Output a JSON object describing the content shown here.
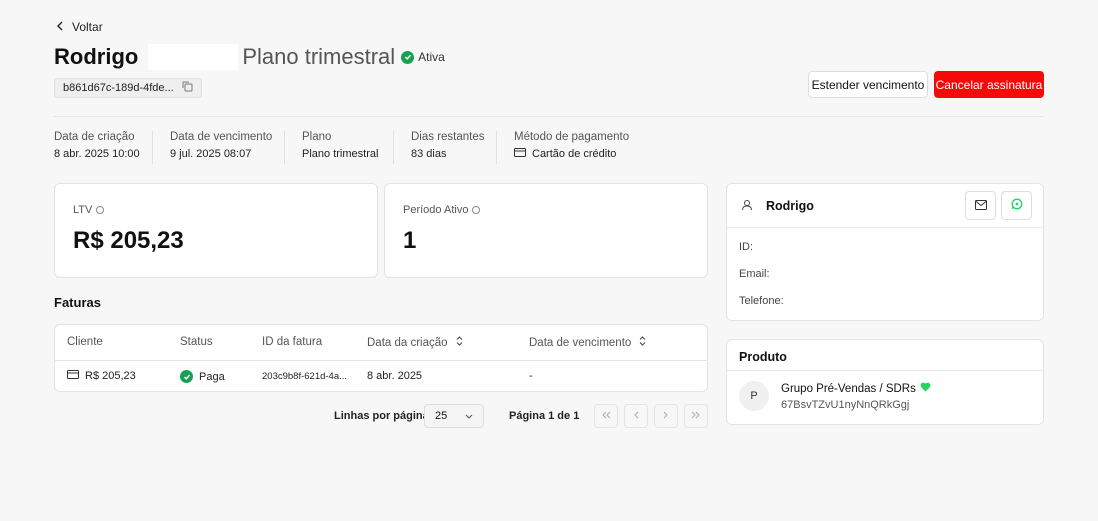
{
  "header": {
    "back_label": "Voltar",
    "customer_name": "Rodrigo",
    "plan_name": "Plano trimestral",
    "status": "Ativa",
    "subscription_id": "b861d67c-189d-4fde...",
    "extend_button": "Estender vencimento",
    "cancel_button": "Cancelar assinatura"
  },
  "meta": [
    {
      "label": "Data de criação",
      "value": "8 abr. 2025 10:00"
    },
    {
      "label": "Data de vencimento",
      "value": "9 jul. 2025 08:07"
    },
    {
      "label": "Plano",
      "value": "Plano trimestral"
    },
    {
      "label": "Dias restantes",
      "value": "83 dias"
    },
    {
      "label": "Método de pagamento",
      "value": "Cartão de crédito"
    }
  ],
  "stats": {
    "ltv_label": "LTV",
    "ltv_value": "R$ 205,23",
    "active_label": "Período Ativo",
    "active_value": "1"
  },
  "invoices": {
    "title": "Faturas",
    "columns": [
      "Cliente",
      "Status",
      "ID da fatura",
      "Data da criação",
      "Data de vencimento"
    ],
    "rows": [
      {
        "client": "R$ 205,23",
        "status": "Paga",
        "invoice_id": "203c9b8f-621d-4a...",
        "created": "8 abr. 2025",
        "due": "-"
      }
    ],
    "pagination": {
      "rows_per_page_label": "Linhas por página",
      "rows_per_page_value": "25",
      "page_label": "Página 1 de 1"
    }
  },
  "customer": {
    "name": "Rodrigo",
    "id_label": "ID:",
    "email_label": "Email:",
    "phone_label": "Telefone:"
  },
  "product": {
    "title": "Produto",
    "avatar_letter": "P",
    "name": "Grupo Pré-Vendas / SDRs",
    "id": "67BsvTZvU1nyNnQRkGgj"
  },
  "colors": {
    "accent_red": "#f50a0a",
    "success_green": "#1aa052",
    "whatsapp_green": "#25d366"
  }
}
